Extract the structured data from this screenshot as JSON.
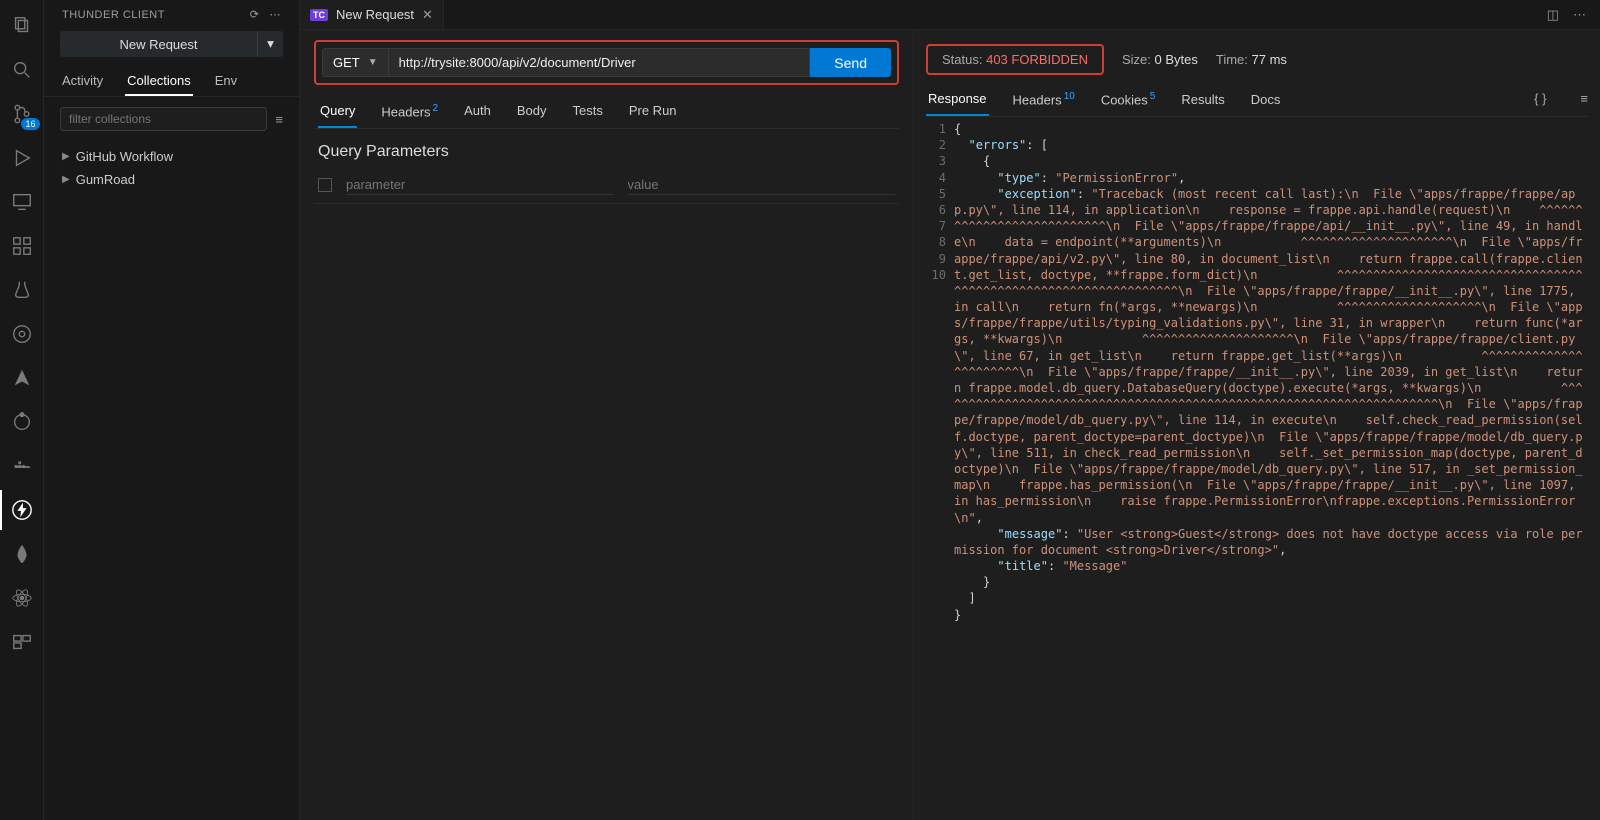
{
  "activity": {
    "badge": "16"
  },
  "sidebar": {
    "title": "THUNDER CLIENT",
    "new_request": "New Request",
    "tabs": {
      "activity": "Activity",
      "collections": "Collections",
      "env": "Env"
    },
    "filter_placeholder": "filter collections",
    "items": [
      {
        "label": "GitHub Workflow"
      },
      {
        "label": "GumRoad"
      }
    ]
  },
  "tabs": {
    "badge": "TC",
    "title": "New Request"
  },
  "request": {
    "method": "GET",
    "url": "http://trysite:8000/api/v2/document/Driver",
    "send": "Send",
    "tabs": {
      "query": "Query",
      "headers": "Headers",
      "headers_count": "2",
      "auth": "Auth",
      "body": "Body",
      "tests": "Tests",
      "pre_run": "Pre Run"
    },
    "qp_title": "Query Parameters",
    "qp_param_placeholder": "parameter",
    "qp_value_placeholder": "value"
  },
  "response": {
    "status_label": "Status:",
    "status_value": "403 FORBIDDEN",
    "size_label": "Size:",
    "size_value": "0 Bytes",
    "time_label": "Time:",
    "time_value": "77 ms",
    "tabs": {
      "response": "Response",
      "headers": "Headers",
      "headers_count": "10",
      "cookies": "Cookies",
      "cookies_count": "5",
      "results": "Results",
      "docs": "Docs"
    },
    "json_lines": [
      "{",
      "  \"errors\": [",
      "    {",
      "      \"type\": \"PermissionError\",",
      "      \"exception\": \"Traceback (most recent call last):\\n  File \\\"apps/frappe/frappe/app.py\\\", line 114, in application\\n    response = frappe.api.handle(request)\\n    ^^^^^^^^^^^^^^^^^^^^^^^^^^^\\n  File \\\"apps/frappe/frappe/api/__init__.py\\\", line 49, in handle\\n    data = endpoint(**arguments)\\n           ^^^^^^^^^^^^^^^^^^^^^\\n  File \\\"apps/frappe/frappe/api/v2.py\\\", line 80, in document_list\\n    return frappe.call(frappe.client.get_list, doctype, **frappe.form_dict)\\n           ^^^^^^^^^^^^^^^^^^^^^^^^^^^^^^^^^^^^^^^^^^^^^^^^^^^^^^^^^^^^^^^^^\\n  File \\\"apps/frappe/frappe/__init__.py\\\", line 1775, in call\\n    return fn(*args, **newargs)\\n           ^^^^^^^^^^^^^^^^^^^^\\n  File \\\"apps/frappe/frappe/utils/typing_validations.py\\\", line 31, in wrapper\\n    return func(*args, **kwargs)\\n           ^^^^^^^^^^^^^^^^^^^^^\\n  File \\\"apps/frappe/frappe/client.py\\\", line 67, in get_list\\n    return frappe.get_list(**args)\\n           ^^^^^^^^^^^^^^^^^^^^^^^\\n  File \\\"apps/frappe/frappe/__init__.py\\\", line 2039, in get_list\\n    return frappe.model.db_query.DatabaseQuery(doctype).execute(*args, **kwargs)\\n           ^^^^^^^^^^^^^^^^^^^^^^^^^^^^^^^^^^^^^^^^^^^^^^^^^^^^^^^^^^^^^^^^^^^^^^\\n  File \\\"apps/frappe/frappe/model/db_query.py\\\", line 114, in execute\\n    self.check_read_permission(self.doctype, parent_doctype=parent_doctype)\\n  File \\\"apps/frappe/frappe/model/db_query.py\\\", line 511, in check_read_permission\\n    self._set_permission_map(doctype, parent_doctype)\\n  File \\\"apps/frappe/frappe/model/db_query.py\\\", line 517, in _set_permission_map\\n    frappe.has_permission(\\n  File \\\"apps/frappe/frappe/__init__.py\\\", line 1097, in has_permission\\n    raise frappe.PermissionError\\nfrappe.exceptions.PermissionError\\n\",",
      "      \"message\": \"User <strong>Guest</strong> does not have doctype access via role permission for document <strong>Driver</strong>\",",
      "      \"title\": \"Message\"",
      "    }",
      "  ]",
      "}"
    ]
  }
}
